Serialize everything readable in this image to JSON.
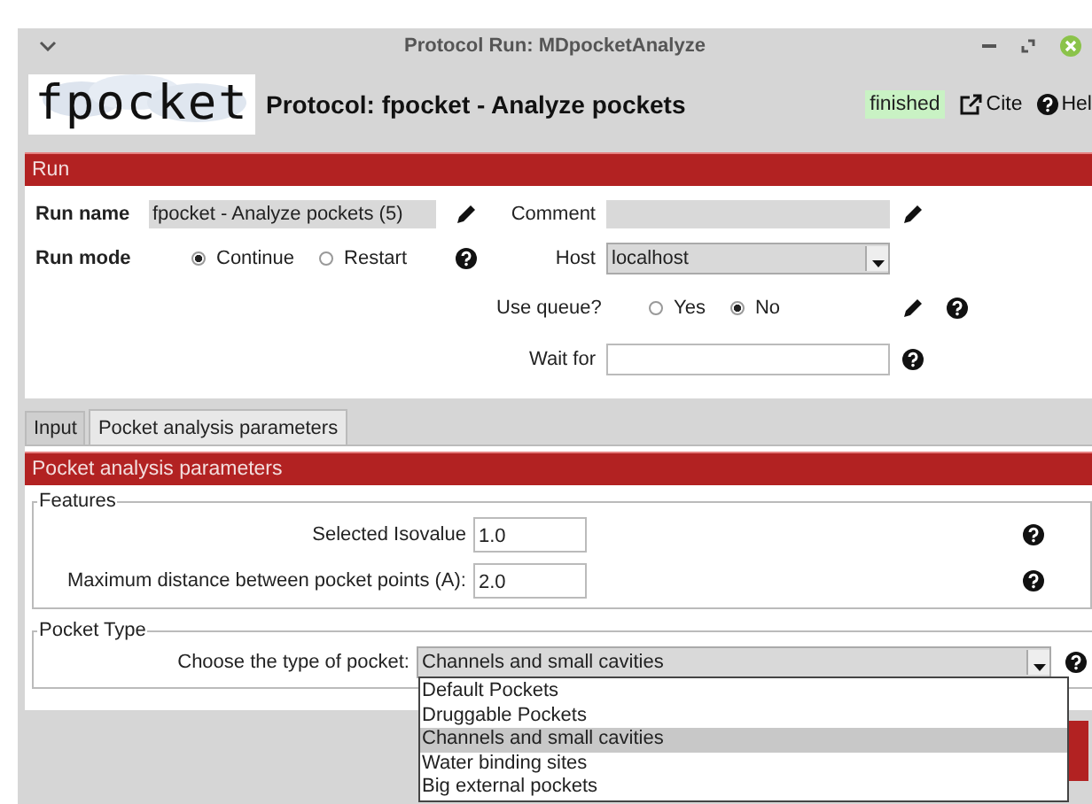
{
  "window": {
    "title": "Protocol Run: MDpocketAnalyze"
  },
  "header": {
    "logo_text": "fpocket",
    "title": "Protocol: fpocket - Analyze pockets",
    "status": "finished",
    "cite": "Cite",
    "help": "Hel"
  },
  "run_section": {
    "title": "Run",
    "run_name": {
      "label": "Run name",
      "value": "fpocket - Analyze pockets (5)"
    },
    "comment": {
      "label": "Comment"
    },
    "run_mode": {
      "label": "Run mode",
      "options": [
        {
          "label": "Continue",
          "selected": true
        },
        {
          "label": "Restart",
          "selected": false
        }
      ]
    },
    "host": {
      "label": "Host",
      "value": "localhost"
    },
    "use_queue": {
      "label": "Use queue?",
      "options": [
        {
          "label": "Yes",
          "selected": false
        },
        {
          "label": "No",
          "selected": true
        }
      ]
    },
    "wait_for": {
      "label": "Wait for"
    }
  },
  "tabs": [
    {
      "label": "Input",
      "selected": false
    },
    {
      "label": "Pocket analysis parameters",
      "selected": true
    }
  ],
  "params_section": {
    "title": "Pocket analysis parameters",
    "features": {
      "legend": "Features",
      "fields": [
        {
          "label": "Selected Isovalue",
          "value": "1.0"
        },
        {
          "label": "Maximum distance between pocket points (A):",
          "value": "2.0"
        }
      ]
    },
    "pocket_type": {
      "legend": "Pocket Type",
      "label": "Choose the type of pocket:",
      "value": "Channels and small cavities",
      "expanded": true,
      "options": [
        {
          "label": "Default Pockets",
          "selected": false
        },
        {
          "label": "Druggable Pockets",
          "selected": false
        },
        {
          "label": "Channels and small cavities",
          "selected": true
        },
        {
          "label": "Water binding sites",
          "selected": false
        },
        {
          "label": "Big external pockets",
          "selected": false
        }
      ]
    }
  }
}
